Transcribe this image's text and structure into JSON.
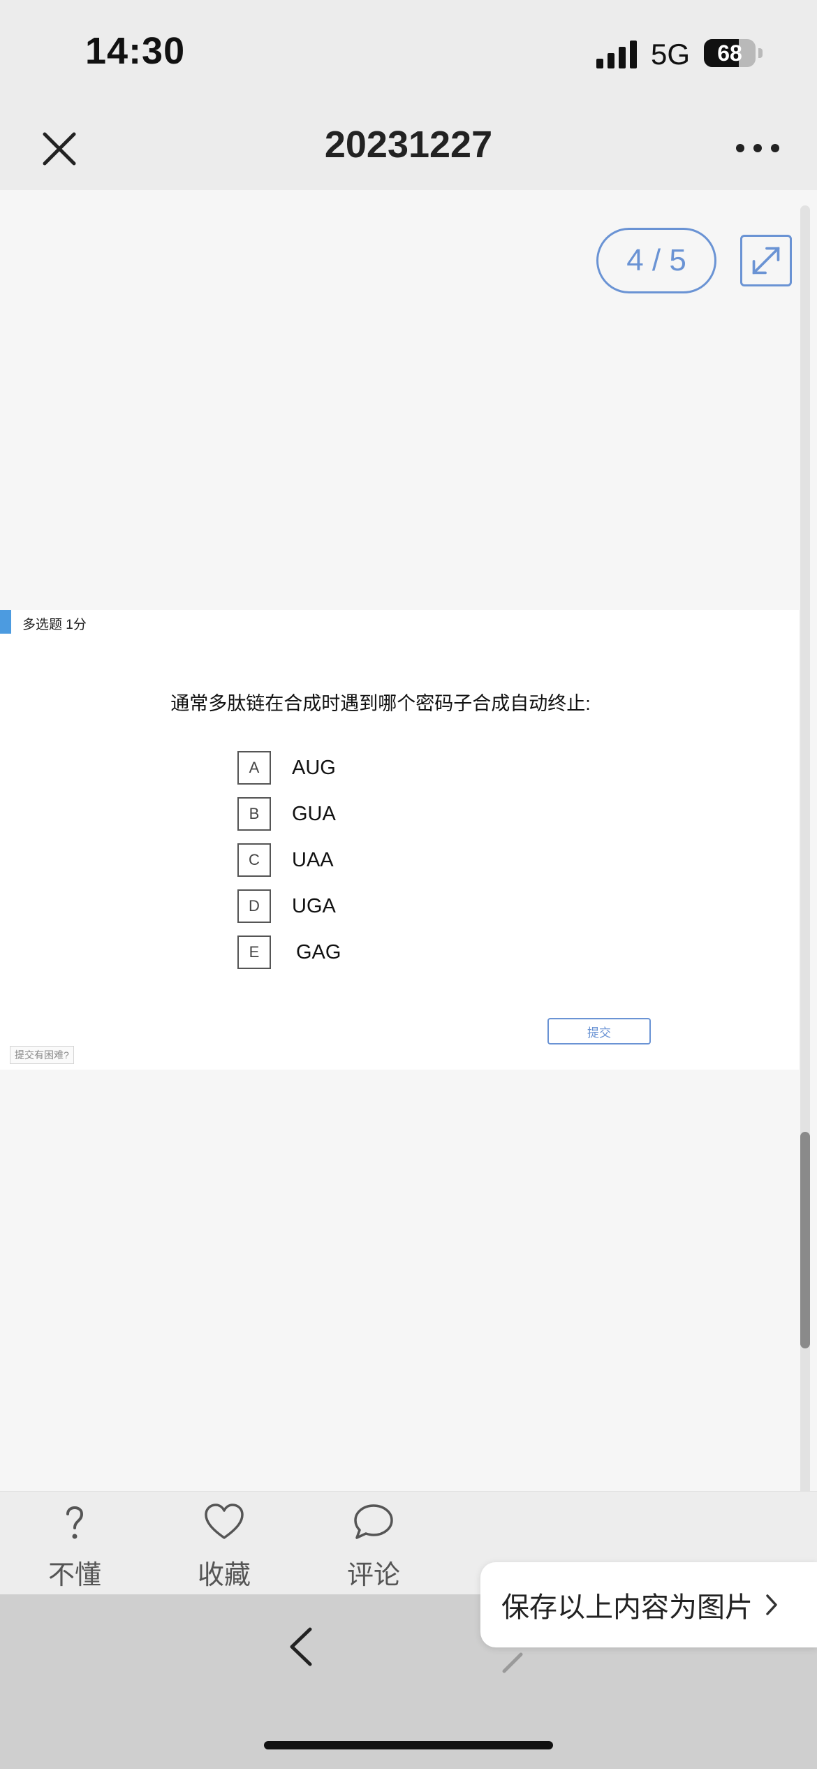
{
  "status_bar": {
    "time": "14:30",
    "network": "5G",
    "battery_level": "68",
    "battery_fraction": 0.68
  },
  "header": {
    "title": "20231227"
  },
  "pager": {
    "label": "4 / 5"
  },
  "question": {
    "type_label": "多选题 1分",
    "text": "通常多肽链在合成时遇到哪个密码子合成自动终止:",
    "options": [
      {
        "letter": "A",
        "text": "AUG"
      },
      {
        "letter": "B",
        "text": "GUA"
      },
      {
        "letter": "C",
        "text": "UAA"
      },
      {
        "letter": "D",
        "text": "UGA"
      },
      {
        "letter": "E",
        "text": "GAG"
      }
    ],
    "submit_label": "提交",
    "help_label": "提交有困难?"
  },
  "bottom_actions": [
    {
      "icon": "question-icon",
      "label": "不懂"
    },
    {
      "icon": "heart-icon",
      "label": "收藏"
    },
    {
      "icon": "comment-icon",
      "label": "评论"
    }
  ],
  "save_popup": {
    "label": "保存以上内容为图片"
  },
  "colors": {
    "accent": "#6a93d4",
    "marker": "#4c9be0"
  }
}
